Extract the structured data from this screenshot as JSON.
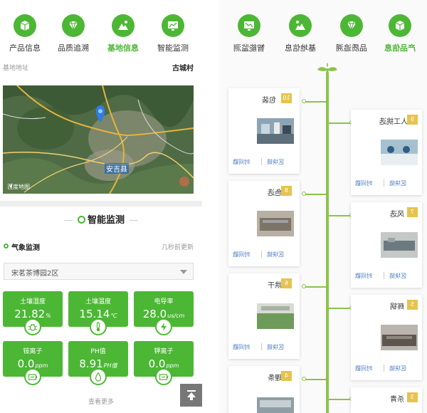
{
  "colors": {
    "accent": "#4cb734",
    "badge": "#e6c34d",
    "link": "#4a7bbf"
  },
  "left": {
    "nav": [
      {
        "label": "产品信息",
        "icon": "cube-icon",
        "active": false
      },
      {
        "label": "品质追溯",
        "icon": "diamond-icon",
        "active": false
      },
      {
        "label": "基地信息",
        "icon": "mountain-icon",
        "active": true
      },
      {
        "label": "智能监测",
        "icon": "monitor-chart-icon",
        "active": false
      }
    ],
    "base_address_label": "基地地址",
    "base_address_value": "古城村",
    "map": {
      "city_label": "安吉县",
      "brand": "百度地图"
    },
    "smart_title": "智能监测",
    "weather_title": "气象监测",
    "updated": "几秒前更新",
    "station_select": "宋茗茶博园2区",
    "cards": [
      {
        "label": "土壤湿度",
        "value": "21.82",
        "unit": "%",
        "icon": "bug-icon"
      },
      {
        "label": "土壤温度",
        "value": "15.14",
        "unit": "℃",
        "icon": "thermometer-icon"
      },
      {
        "label": "电导率",
        "value": "28.0",
        "unit": "us/cm",
        "icon": "lightning-icon"
      },
      {
        "label": "铵离子",
        "value": "0.0",
        "unit": "ppm",
        "icon": "battery-icon"
      },
      {
        "label": "PH值",
        "value": "8.91",
        "unit": "PH值",
        "icon": "droplet-icon"
      },
      {
        "label": "钾离子",
        "value": "0.0",
        "unit": "ppm",
        "icon": "battery-icon"
      }
    ],
    "more": "查看更多"
  },
  "right": {
    "nav": [
      {
        "label": "产品信息",
        "active": true
      },
      {
        "label": "品质追溯",
        "active": false
      },
      {
        "label": "基地信息",
        "active": false
      },
      {
        "label": "智能监测",
        "active": false
      }
    ],
    "steps": [
      {
        "num": "10",
        "name": "包装",
        "side": "left"
      },
      {
        "num": "9",
        "name": "人工挑选",
        "side": "right"
      },
      {
        "num": "8",
        "name": "色选",
        "side": "left"
      },
      {
        "num": "7",
        "name": "风选",
        "side": "right"
      },
      {
        "num": "6",
        "name": "烘干",
        "side": "left"
      },
      {
        "num": "5",
        "name": "辉锅",
        "side": "right"
      },
      {
        "num": "4",
        "name": "理条",
        "side": "left"
      },
      {
        "num": "3",
        "name": "杀青",
        "side": "right"
      }
    ],
    "blockchain_label": "区块链",
    "time_label": "时间戳"
  }
}
